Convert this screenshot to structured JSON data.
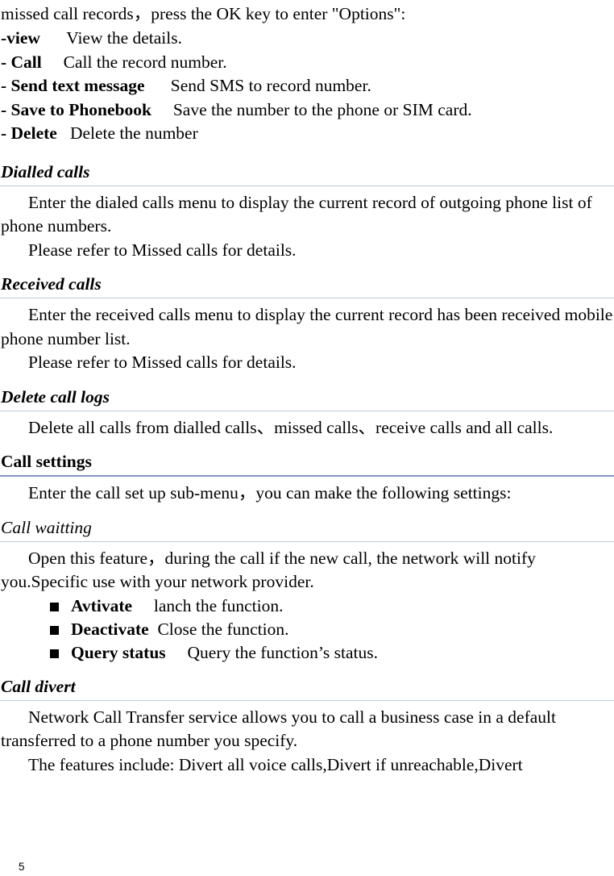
{
  "document": {
    "page_number": "5",
    "rule_color_h1": "#8496C8",
    "rule_color_h2": "#BCCBDD"
  },
  "intro": {
    "line": "missed call records，press the OK key to enter \"Options\":"
  },
  "options": [
    {
      "key": "-view",
      "desc": "View the details."
    },
    {
      "key": "- Call",
      "desc": "Call the record number."
    },
    {
      "key": "- Send text message",
      "desc": "Send SMS to record number."
    },
    {
      "key": "- Save to Phonebook",
      "desc": "Save the number to the phone or SIM card."
    },
    {
      "key": "- Delete",
      "desc": "Delete the number"
    }
  ],
  "sections": {
    "dialled_calls": {
      "heading": "Dialled calls",
      "p1": "Enter the dialed calls menu to display the current record of outgoing phone list of phone numbers.",
      "p2": "Please refer to Missed calls for details."
    },
    "received_calls": {
      "heading": "Received calls",
      "p1": "Enter the received calls menu to display the current record has been received mobile phone number list.",
      "p2": "Please refer to Missed calls for details."
    },
    "delete_call_logs": {
      "heading": "Delete call logs",
      "p1": "Delete all calls from dialled calls、missed calls、receive calls and all calls."
    },
    "call_settings": {
      "heading": "Call settings",
      "p1": "Enter the call set up sub-menu，you can make the following settings:"
    },
    "call_waitting": {
      "heading": "Call waitting",
      "p1": "Open this feature，during the call if the new call, the network will notify you.Specific use with your network provider.",
      "bullets": [
        {
          "key": "Avtivate",
          "desc": "lanch the function."
        },
        {
          "key": "Deactivate",
          "desc": "Close the function."
        },
        {
          "key": "Query status",
          "desc": "Query the function’s status."
        }
      ]
    },
    "call_divert": {
      "heading": "Call divert",
      "p1": "Network Call Transfer service allows you to call a business case in a default transferred to a phone number you specify.",
      "p2": "The features include: Divert all voice calls,Divert if unreachable,Divert"
    }
  }
}
